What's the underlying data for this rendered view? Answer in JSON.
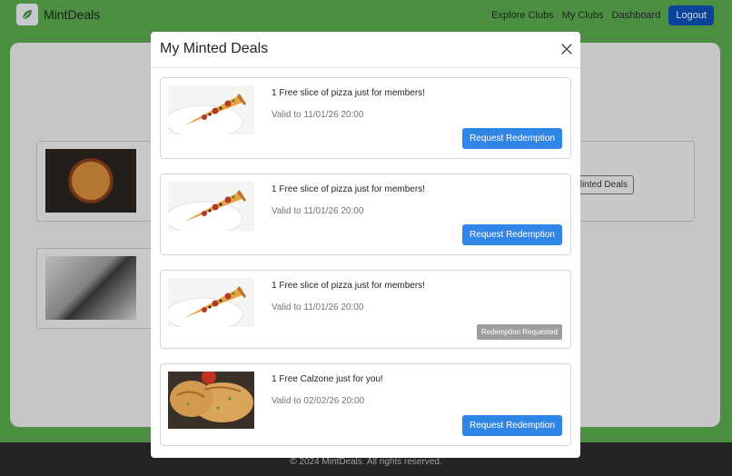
{
  "navbar": {
    "brand": "MintDeals",
    "links": [
      "Explore Clubs",
      "My Clubs",
      "Dashboard"
    ],
    "logout": "Logout"
  },
  "background": {
    "minted_button_partial": "linted Deals"
  },
  "footer": {
    "text": "© 2024 MintDeals. All rights reserved."
  },
  "modal": {
    "title": "My Minted Deals",
    "deals": [
      {
        "title": "1 Free slice of pizza just for members!",
        "valid": "Valid to 11/01/26 20:00",
        "action": "Request Redemption",
        "image": "pizza-slice"
      },
      {
        "title": "1 Free slice of pizza just for members!",
        "valid": "Valid to 11/01/26 20:00",
        "action": "Request Redemption",
        "image": "pizza-slice"
      },
      {
        "title": "1 Free slice of pizza just for members!",
        "valid": "Valid to 11/01/26 20:00",
        "action": "Redemption Requested",
        "image": "pizza-slice"
      },
      {
        "title": "1 Free Calzone just for you!",
        "valid": "Valid to 02/02/26 20:00",
        "action": "Request Redemption",
        "image": "calzone"
      }
    ]
  },
  "colors": {
    "nav_green": "#5aa84f",
    "logout_blue": "#0d4fb6",
    "redeem_blue": "#2f86e6",
    "requested_gray": "#9e9e9e",
    "footer_dark": "#2b2b2b"
  }
}
